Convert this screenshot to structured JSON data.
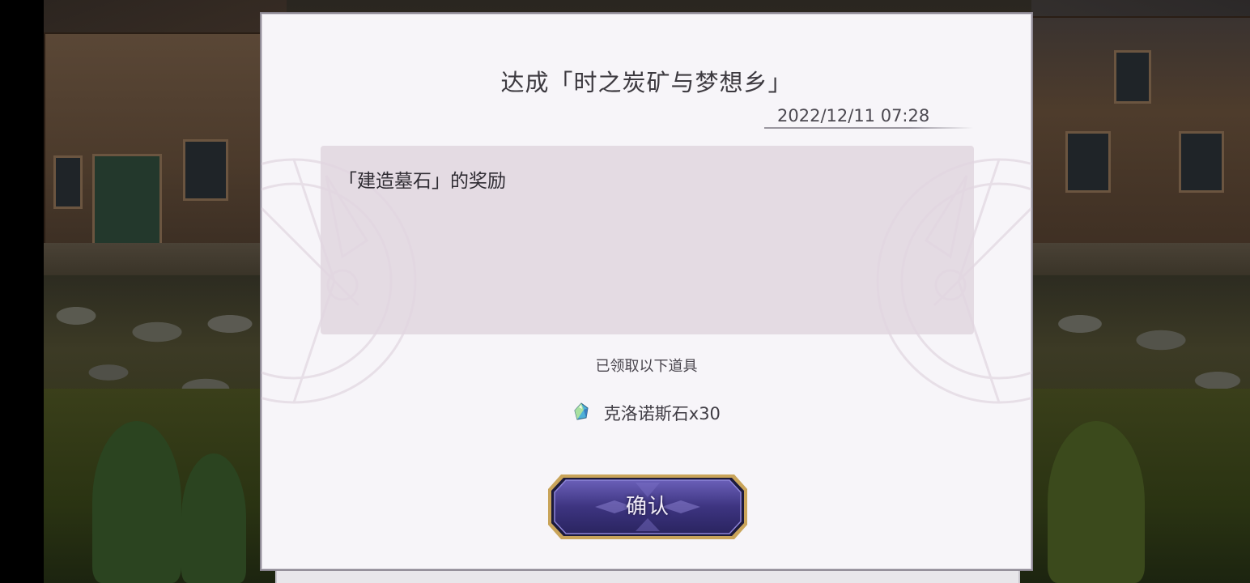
{
  "dialog": {
    "title": "达成「时之炭矿与梦想乡」",
    "timestamp": "2022/12/11 07:28",
    "message": "「建造墓石」的奖励",
    "received_label": "已领取以下道具",
    "reward": {
      "icon": "chronos-stone-gem-icon",
      "text": "克洛诺斯石x30"
    },
    "confirm_label": "确认"
  },
  "colors": {
    "dialog_bg": "#f7f5f9",
    "message_box_bg": "#e1d6df",
    "button_fill": "#4a3f8c",
    "button_border": "#c9a45a"
  }
}
